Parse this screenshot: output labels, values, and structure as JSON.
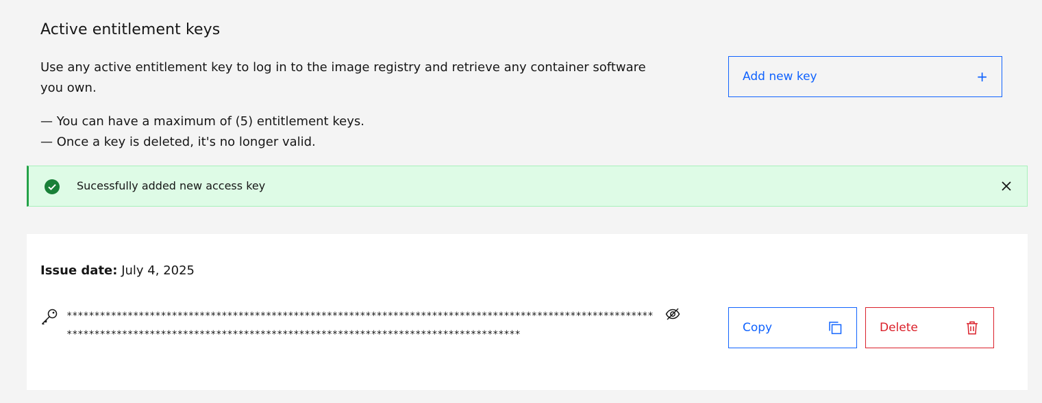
{
  "section": {
    "title": "Active entitlement keys",
    "description": "Use any active entitlement key to log in to the image registry and retrieve any container software you own.",
    "notes": [
      "— You can have a maximum of (5) entitlement keys.",
      "— Once a key is deleted, it's no longer valid."
    ],
    "add_button": {
      "label": "Add new key",
      "icon": "+"
    }
  },
  "notification": {
    "kind": "success",
    "message": "Sucessfully added new access key",
    "icons": {
      "status": "checkmark-filled-icon",
      "close": "close-icon"
    }
  },
  "key_card": {
    "issue_label": "Issue date:",
    "issue_date": "July 4, 2025",
    "masked_key": "********************************************************************************************************************************************************************************************",
    "icons": {
      "key": "key-icon",
      "visibility": "view-off-icon"
    },
    "copy_button": {
      "label": "Copy",
      "icon": "copy-icon"
    },
    "delete_button": {
      "label": "Delete",
      "icon": "trash-can-icon"
    }
  },
  "colors": {
    "background": "#f4f4f4",
    "primary": "#0f62fe",
    "danger": "#da1e28",
    "success": "#24a148",
    "success_bg": "#defbe6"
  }
}
